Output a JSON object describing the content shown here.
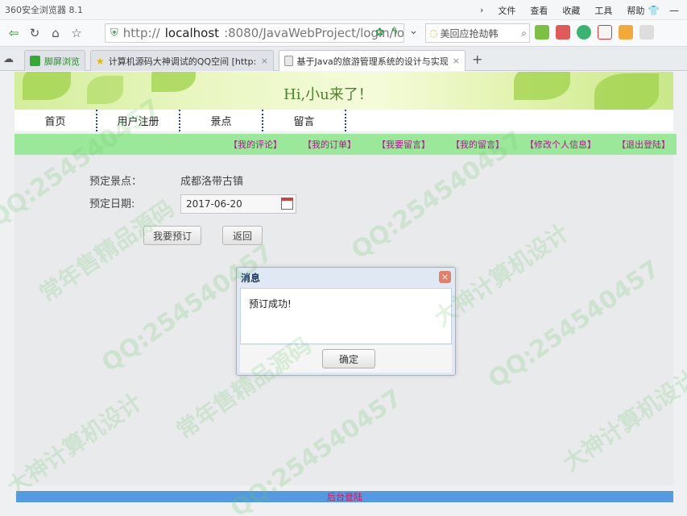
{
  "browser": {
    "app_title": "360安全浏览器 8.1",
    "menus": [
      "文件",
      "查看",
      "收藏",
      "工具",
      "帮助"
    ],
    "address": {
      "prefix": "http://",
      "host": "localhost",
      "rest": ":8080/JavaWebProject/login/lo"
    },
    "search_placeholder": "美回应抢劫韩",
    "tabs": [
      {
        "label": "脚屏浏览"
      },
      {
        "label": "计算机源码大神调试的QQ空间 [http:"
      },
      {
        "label": "基于Java的旅游管理系统的设计与实现"
      }
    ],
    "new_tab_symbol": "+"
  },
  "site": {
    "greeting": "Hi,小u来了！",
    "nav": [
      "首页",
      "用户注册",
      "景点",
      "留言"
    ],
    "sub_nav": [
      "【我的评论】",
      "【我的订单】",
      "【我要留言】",
      "【我的留言】",
      "【修改个人信息】",
      "【退出登陆】"
    ]
  },
  "form": {
    "spot_label": "预定景点：",
    "spot_value": "成都洛带古镇",
    "date_label": "预定日期:",
    "date_value": "2017-06-20",
    "submit_label": "我要预订",
    "back_label": "返回"
  },
  "dialog": {
    "title": "消息",
    "message": "预订成功!",
    "ok_label": "确定"
  },
  "footer": {
    "link": "后台登陆"
  },
  "watermarks": [
    "QQ:254540457",
    "常年售精品源码",
    "大神计算机设计"
  ],
  "colors": {
    "sub_nav_bg": "#9be89b",
    "sub_nav_link": "#b0168f",
    "footer_bg": "#5599e0",
    "footer_link": "#d4145a"
  }
}
